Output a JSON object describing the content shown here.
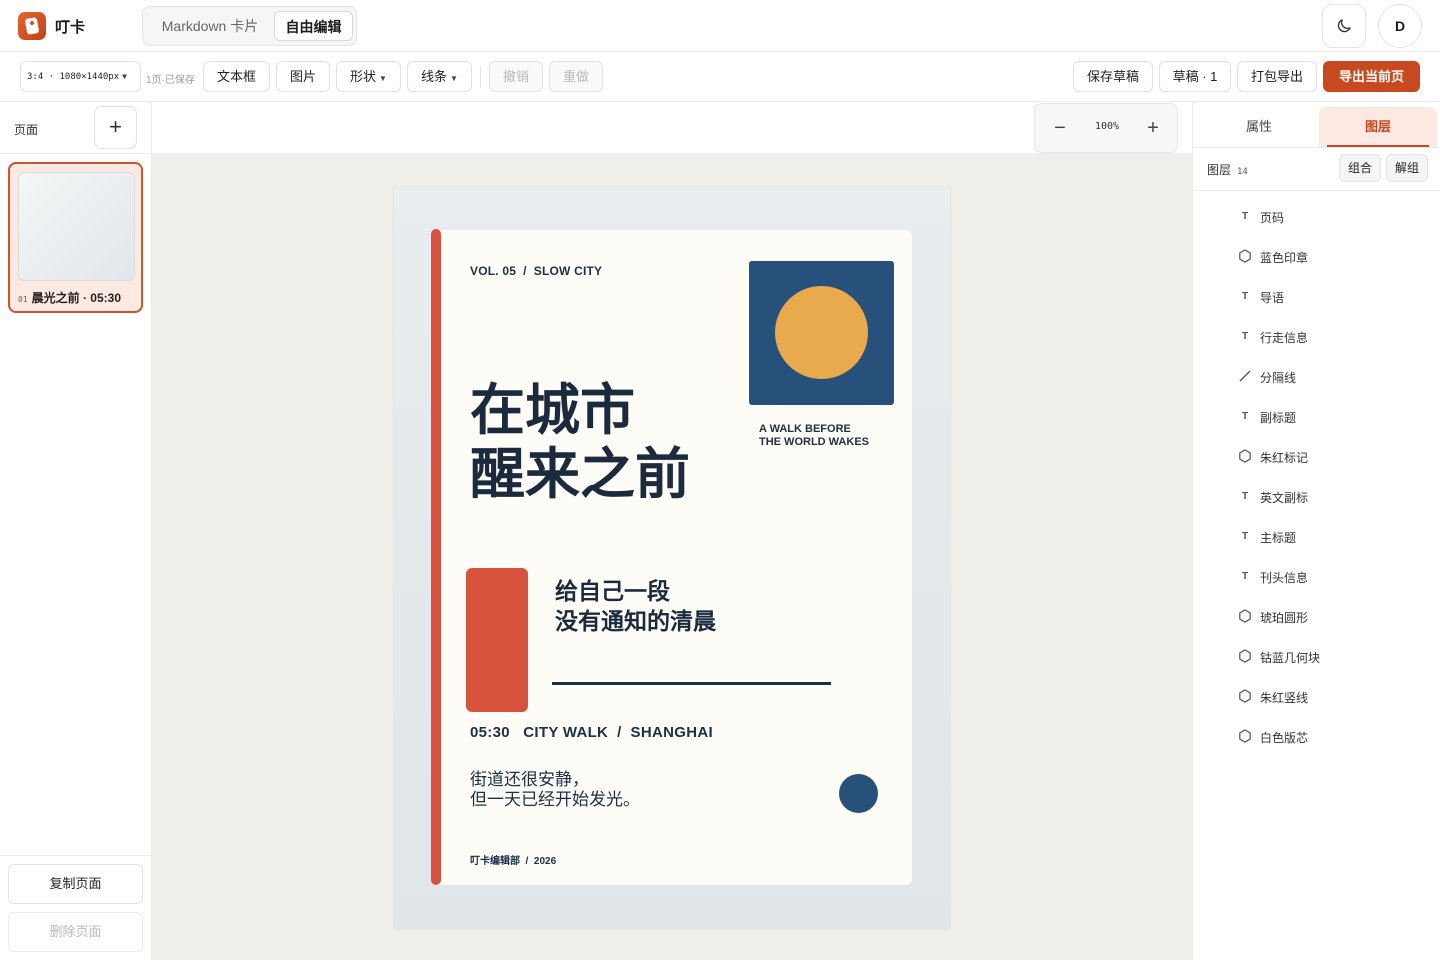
{
  "app": {
    "name": "叮卡"
  },
  "modes": {
    "markdown": "Markdown 卡片",
    "free": "自由编辑"
  },
  "user": {
    "initial": "D"
  },
  "toolbar": {
    "size": "3:4 · 1080×1440px",
    "save_status": "1页·已保存",
    "textbox": "文本框",
    "image": "图片",
    "shape": "形状",
    "line": "线条",
    "undo": "撤销",
    "redo": "重做",
    "save_draft": "保存草稿",
    "drafts": "草稿 · 1",
    "pack_export": "打包导出",
    "export_current": "导出当前页"
  },
  "pages": {
    "label": "页面",
    "add": "+",
    "items": [
      {
        "num": "01",
        "title": "晨光之前 · 05:30"
      }
    ],
    "copy": "复制页面",
    "delete": "删除页面"
  },
  "zoom": {
    "minus": "−",
    "value": "100%",
    "plus": "+"
  },
  "poster": {
    "vol": "VOL. 05  /  SLOW CITY",
    "en_line1": "A WALK BEFORE",
    "en_line2": "THE WORLD WAKES",
    "title_line1": "在城市",
    "title_line2": "醒来之前",
    "sub_line1": "给自己一段",
    "sub_line2": "没有通知的清晨",
    "walk_info": "05:30   CITY WALK  /  SHANGHAI",
    "lead_line1": "街道还很安静，",
    "lead_line2": "但一天已经开始发光。",
    "page_num": "叮卡编辑部  /  2026",
    "colors": {
      "red": "#d7523c",
      "navy": "#27517a",
      "amber": "#e8aa4c",
      "ink": "#1b2a3d",
      "paper": "#fdfcf6"
    }
  },
  "right_panel": {
    "tabs": {
      "props": "属性",
      "layers": "图层"
    },
    "layers_label": "图层",
    "layers_count": "14",
    "group": "组合",
    "ungroup": "解组",
    "layers": [
      {
        "type": "text",
        "icon": "T",
        "name": "页码"
      },
      {
        "type": "shape",
        "icon": "hexagon",
        "name": "蓝色印章"
      },
      {
        "type": "text",
        "icon": "T",
        "name": "导语"
      },
      {
        "type": "text",
        "icon": "T",
        "name": "行走信息"
      },
      {
        "type": "line",
        "icon": "line",
        "name": "分隔线"
      },
      {
        "type": "text",
        "icon": "T",
        "name": "副标题"
      },
      {
        "type": "shape",
        "icon": "hexagon",
        "name": "朱红标记"
      },
      {
        "type": "text",
        "icon": "T",
        "name": "英文副标"
      },
      {
        "type": "text",
        "icon": "T",
        "name": "主标题"
      },
      {
        "type": "text",
        "icon": "T",
        "name": "刊头信息"
      },
      {
        "type": "shape",
        "icon": "hexagon",
        "name": "琥珀圆形"
      },
      {
        "type": "shape",
        "icon": "hexagon",
        "name": "钴蓝几何块"
      },
      {
        "type": "shape",
        "icon": "hexagon",
        "name": "朱红竖线"
      },
      {
        "type": "shape",
        "icon": "hexagon",
        "name": "白色版芯"
      }
    ]
  }
}
